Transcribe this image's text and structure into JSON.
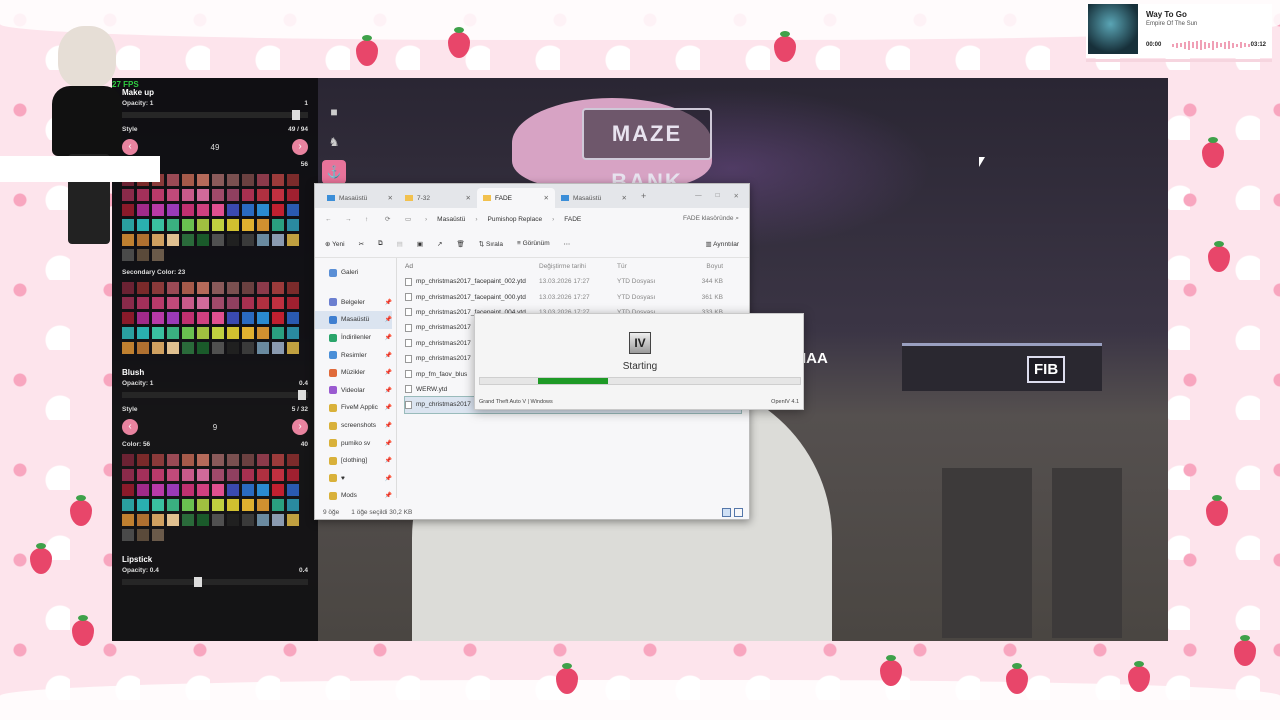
{
  "overlay": {
    "fps": "27 FPS"
  },
  "music": {
    "title": "Way To Go",
    "artist": "Empire Of The Sun",
    "time_current": "00:00",
    "time_total": "03:12",
    "progress": 0.0
  },
  "makeup_panel": {
    "header": "Make up",
    "opacity1_label": "Opacity: 1",
    "opacity1_value": "1",
    "style_label": "Style",
    "style_range": "49 / 94",
    "style_value": "49",
    "color_count": "56",
    "secondary_color_label": "Secondary Color: 23",
    "blush": {
      "title": "Blush",
      "opacity_label": "Opacity: 1",
      "opacity_value": "0.4",
      "style_label": "Style",
      "style_range": "5 / 32",
      "style_value": "9",
      "color_label": "Color: 56",
      "color_count": "40"
    },
    "lipstick": {
      "title": "Lipstick",
      "opacity_label": "Opacity: 0.4",
      "opacity_value": "0.4"
    }
  },
  "explorer": {
    "tabs": [
      {
        "label": "Masaüstü",
        "active": false
      },
      {
        "label": "7-32",
        "active": false
      },
      {
        "label": "FADE",
        "active": true
      },
      {
        "label": "Masaüstü",
        "active": false
      }
    ],
    "breadcrumb": [
      "Masaüstü",
      "Pumishop Replace",
      "FADE"
    ],
    "search_placeholder": "FADE klasöründe",
    "commands": {
      "new": "Yeni",
      "sort": "Sırala",
      "view": "Görünüm",
      "details": "Ayrıntılar"
    },
    "sidebar": [
      {
        "label": "Galeri",
        "pinned": false,
        "selected": false
      },
      {
        "label": "Belgeler",
        "pinned": true,
        "selected": false
      },
      {
        "label": "Masaüstü",
        "pinned": true,
        "selected": true
      },
      {
        "label": "İndirilenler",
        "pinned": true,
        "selected": false
      },
      {
        "label": "Resimler",
        "pinned": true,
        "selected": false
      },
      {
        "label": "Müzikler",
        "pinned": true,
        "selected": false
      },
      {
        "label": "Videolar",
        "pinned": true,
        "selected": false
      },
      {
        "label": "FiveM Applic",
        "pinned": true,
        "selected": false
      },
      {
        "label": "screenshots",
        "pinned": true,
        "selected": false
      },
      {
        "label": "pumiko sv",
        "pinned": true,
        "selected": false
      },
      {
        "label": "[clothing]",
        "pinned": true,
        "selected": false
      },
      {
        "label": "♥",
        "pinned": true,
        "selected": false
      },
      {
        "label": "Mods",
        "pinned": true,
        "selected": false
      }
    ],
    "columns": {
      "name": "Ad",
      "date": "Değiştirme tarihi",
      "type": "Tür",
      "size": "Boyut"
    },
    "files": [
      {
        "name": "mp_christmas2017_facepaint_002.ytd",
        "date": "13.03.2026 17:27",
        "type": "YTD Dosyası",
        "size": "344 KB",
        "selected": false
      },
      {
        "name": "mp_christmas2017_facepaint_000.ytd",
        "date": "13.03.2026 17:27",
        "type": "YTD Dosyası",
        "size": "361 KB",
        "selected": false
      },
      {
        "name": "mp_christmas2017_facepaint_004.ytd",
        "date": "13.03.2026 17:27",
        "type": "YTD Dosyası",
        "size": "333 KB",
        "selected": false
      },
      {
        "name": "mp_christmas2017",
        "date": "",
        "type": "",
        "size": "",
        "selected": false
      },
      {
        "name": "mp_christmas2017",
        "date": "",
        "type": "",
        "size": "",
        "selected": false
      },
      {
        "name": "mp_christmas2017",
        "date": "",
        "type": "",
        "size": "",
        "selected": false
      },
      {
        "name": "mp_fm_faov_blus",
        "date": "",
        "type": "",
        "size": "",
        "selected": false
      },
      {
        "name": "WERW.ytd",
        "date": "",
        "type": "",
        "size": "",
        "selected": false
      },
      {
        "name": "mp_christmas2017",
        "date": "",
        "type": "",
        "size": "",
        "selected": true
      }
    ],
    "status_count": "9 öğe",
    "status_selection": "1 öğe seçildi  30,2 KB"
  },
  "openiv": {
    "logo": "IV",
    "status": "Starting",
    "footer_left": "Grand Theft Auto V | Windows",
    "footer_right": "OpenIV 4.1",
    "progress_start": 0.18,
    "progress_end": 0.4
  },
  "scene": {
    "sign_maze": "MAZE BANK",
    "sign_iaa": "IAA",
    "sign_fib": "FIB"
  },
  "colors": {
    "accent_pink": "#e8839f",
    "progress_green": "#1e9a26"
  },
  "icons": {
    "strip": [
      "camera-icon",
      "walk-icon",
      "anchor-icon"
    ]
  }
}
